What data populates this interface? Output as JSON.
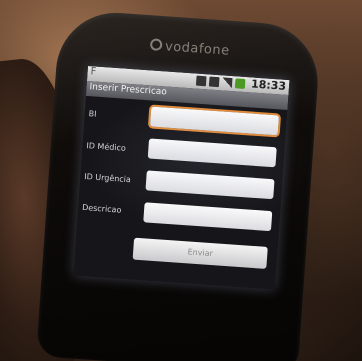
{
  "phone": {
    "brand": "vodafone"
  },
  "status_bar": {
    "time": "18:33",
    "left_glyph": "F",
    "icons": [
      "notification-icon",
      "battery-icon",
      "signal-icon",
      "badge-icon"
    ]
  },
  "app": {
    "title": "Inserir Prescricao",
    "fields": [
      {
        "label": "BI",
        "value": "",
        "focused": true
      },
      {
        "label": "ID Médico",
        "value": ""
      },
      {
        "label": "ID Urgência",
        "value": ""
      },
      {
        "label": "Descricao",
        "value": ""
      }
    ],
    "submit_label": "Enviar"
  },
  "colors": {
    "focus_accent": "#e08a38",
    "status_badge": "#4a9a24"
  }
}
